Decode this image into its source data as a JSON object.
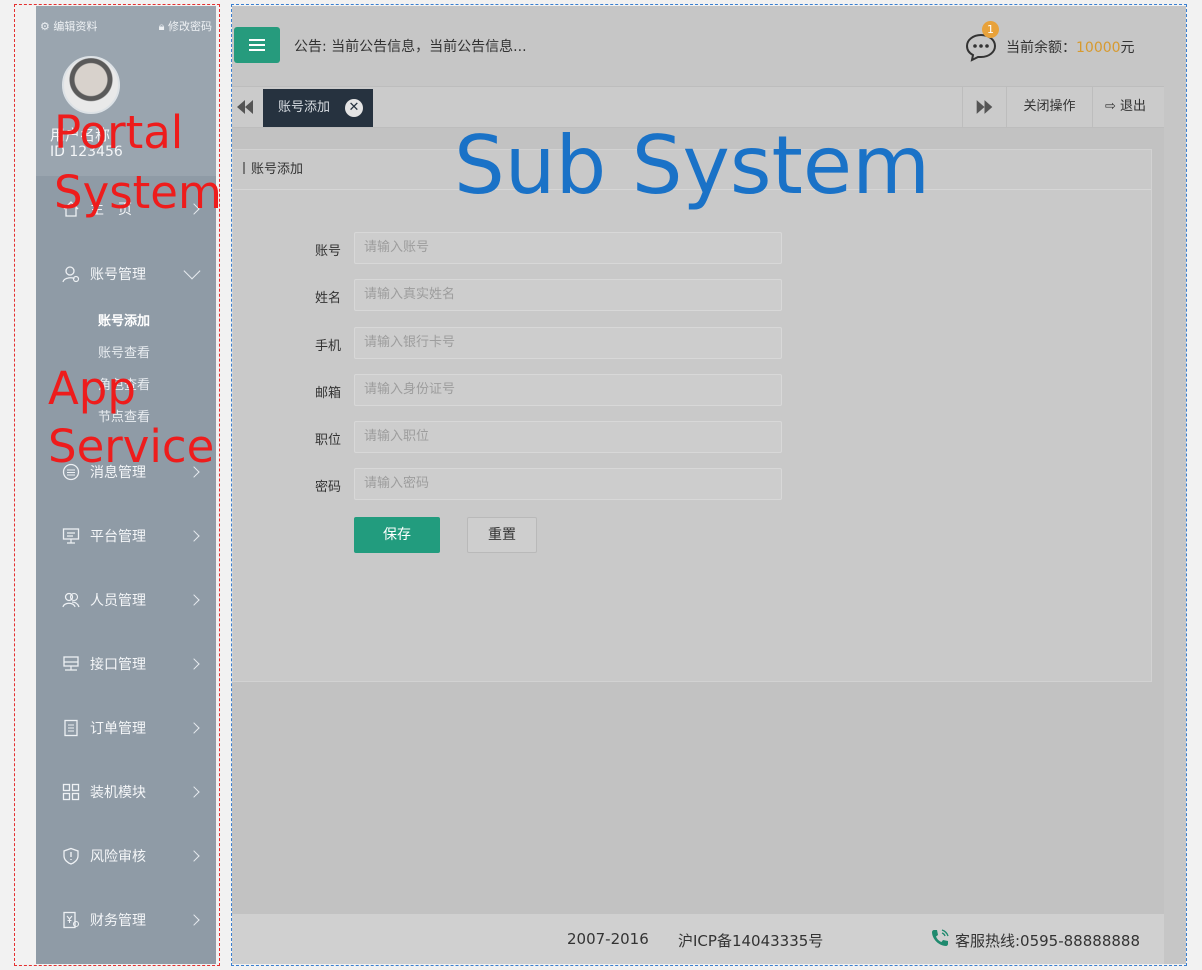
{
  "sidebar": {
    "edit_profile": "编辑资料",
    "change_password": "修改密码",
    "user_name": "用户名称",
    "user_id": "ID 123456",
    "home": "主　页",
    "account_mgmt": "账号管理",
    "sub_items": [
      "账号添加",
      "账号查看",
      "角色查看",
      "节点查看"
    ],
    "items": [
      "消息管理",
      "平台管理",
      "人员管理",
      "接口管理",
      "订单管理",
      "装机模块",
      "风险审核",
      "财务管理"
    ]
  },
  "topbar": {
    "notice": "公告: 当前公告信息，当前公告信息...",
    "badge": "1",
    "balance_label": "当前余额：",
    "balance_amount": "10000",
    "balance_unit": "元"
  },
  "tabs": {
    "active_tab": "账号添加",
    "close_ops": "关闭操作",
    "logout": "退出"
  },
  "panel": {
    "title": "账号添加",
    "fields": [
      {
        "label": "账号",
        "placeholder": "请输入账号"
      },
      {
        "label": "姓名",
        "placeholder": "请输入真实姓名"
      },
      {
        "label": "手机",
        "placeholder": "请输入银行卡号"
      },
      {
        "label": "邮箱",
        "placeholder": "请输入身份证号"
      },
      {
        "label": "职位",
        "placeholder": "请输入职位"
      },
      {
        "label": "密码",
        "placeholder": "请输入密码"
      }
    ],
    "save": "保存",
    "reset": "重置"
  },
  "footer": {
    "copyright": "2007-2016",
    "icp": "沪ICP备14043335号",
    "hotline": "客服热线:0595-88888888"
  },
  "annotations": {
    "portal_1": "Portal",
    "portal_2": "System",
    "app_1": "App",
    "app_2": "Service",
    "sub_system": "Sub System"
  },
  "colors": {
    "accent_green": "#269b7d",
    "amount_orange": "#d79a2f",
    "annotation_red": "#ee1c1c",
    "annotation_blue": "#1a72c7"
  }
}
